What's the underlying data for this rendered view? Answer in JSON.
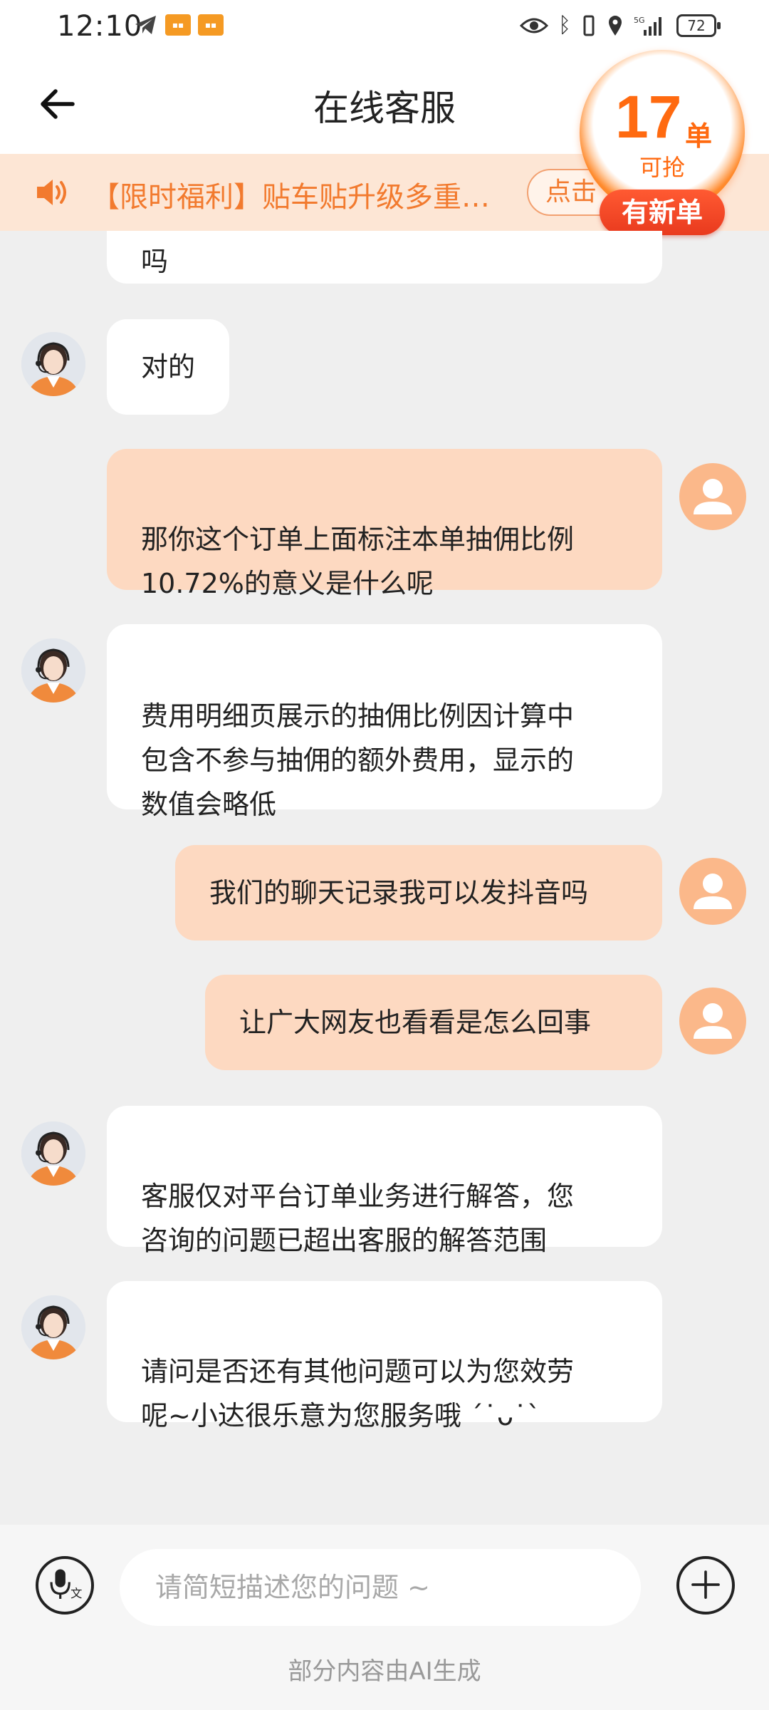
{
  "status_bar": {
    "time": "12:10",
    "battery": "72",
    "network": "5G"
  },
  "header": {
    "title": "在线客服"
  },
  "notice": {
    "text": "【限时福利】贴车贴升级多重…",
    "button": "点击"
  },
  "badge": {
    "count": "17",
    "unit": "单",
    "sub": "可抢",
    "pill": "有新单"
  },
  "messages": [
    {
      "sender": "agent",
      "text": "吗"
    },
    {
      "sender": "agent",
      "text": "对的"
    },
    {
      "sender": "user",
      "text": "那你这个订单上面标注本单抽佣比例\n10.72%的意义是什么呢"
    },
    {
      "sender": "agent",
      "text": "费用明细页展示的抽佣比例因计算中\n包含不参与抽佣的额外费用，显示的\n数值会略低"
    },
    {
      "sender": "user",
      "text": "我们的聊天记录我可以发抖音吗"
    },
    {
      "sender": "user",
      "text": "让广大网友也看看是怎么回事"
    },
    {
      "sender": "agent",
      "text": "客服仅对平台订单业务进行解答，您\n咨询的问题已超出客服的解答范围"
    },
    {
      "sender": "agent",
      "text": "请问是否还有其他问题可以为您效劳\n呢~小达很乐意为您服务哦  ˊ˙ᴗ˙ˋ"
    }
  ],
  "input": {
    "placeholder": "请简短描述您的问题 ~",
    "value": ""
  },
  "footnote": "部分内容由AI生成",
  "colors": {
    "accent": "#ff6a10",
    "user_bubble": "#fdd9c1",
    "notice_bg": "#fde6d5",
    "chat_bg": "#efefef"
  }
}
